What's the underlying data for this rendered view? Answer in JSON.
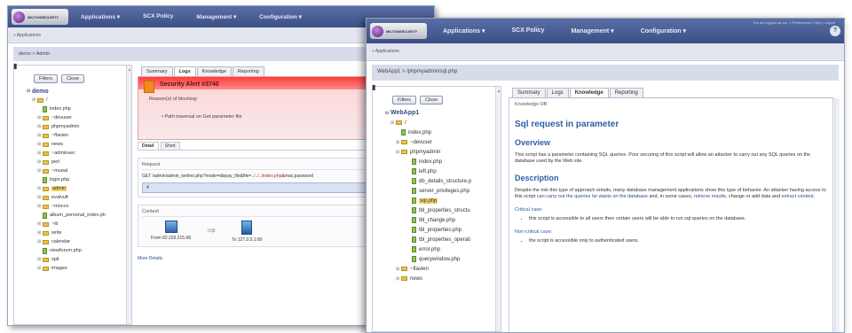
{
  "colors": {
    "nav": "#3b4f86",
    "alert": "#ff3b3b",
    "heading": "#2d5fa8"
  },
  "back": {
    "logo_text": "MILTONSECURITY",
    "menu": [
      "Applications ▾",
      "SCX Policy",
      "Management ▾",
      "Configuration ▾"
    ],
    "bar1": "» Applications",
    "breadcrumb": "demo > Admin",
    "buttons": {
      "filters": "Filters",
      "close": "Close"
    },
    "tree": [
      {
        "label": "demo",
        "type": "root"
      },
      {
        "label": "/",
        "type": "folder"
      },
      {
        "label": "index.php",
        "type": "file"
      },
      {
        "label": "~devuser",
        "type": "folder"
      },
      {
        "label": "phpmyadmin",
        "type": "folder"
      },
      {
        "label": "~flavien",
        "type": "folder"
      },
      {
        "label": "news",
        "type": "folder"
      },
      {
        "label": "~adminsec",
        "type": "folder"
      },
      {
        "label": "perl",
        "type": "folder"
      },
      {
        "label": "~mueal",
        "type": "folder"
      },
      {
        "label": "login.php",
        "type": "file"
      },
      {
        "label": "admin",
        "type": "folder",
        "selected": true
      },
      {
        "label": "evalvuft",
        "type": "folder"
      },
      {
        "label": "~mocco",
        "type": "folder"
      },
      {
        "label": "album_personal_index.ph",
        "type": "file"
      },
      {
        "label": "~iti",
        "type": "folder"
      },
      {
        "label": "write",
        "type": "folder"
      },
      {
        "label": "calendar",
        "type": "folder"
      },
      {
        "label": "viewforum.php",
        "type": "file"
      },
      {
        "label": "spit",
        "type": "folder"
      },
      {
        "label": "images",
        "type": "folder"
      }
    ],
    "tabs": [
      "Summary",
      "Logs",
      "Knowledge",
      "Reporting"
    ],
    "alert": {
      "title": "Security Alert #3740",
      "reason": "Reason(s) of blocking:",
      "bullet": "• Path traversal on Get parameter file"
    },
    "subtabs": [
      "Detail",
      "Short"
    ],
    "request": {
      "header": "Request",
      "line_start": "GET /admin/admin_welrno.php?mode=dispay_file&file=",
      "line_hl": "../../../index.php",
      "line_end": "&mac;password",
      "box": "4"
    },
    "context": {
      "header": "Context",
      "from": "From 82.226.215.68",
      "to": "To 127.0.0.1:80"
    },
    "more": "More Details"
  },
  "front": {
    "logo_text": "MILTONSECURITY",
    "session": "You are logged as ad... | Preferences | Help | Logout",
    "menu": [
      "Applications ▾",
      "SCX Policy",
      "Management ▾",
      "Configuration ▾"
    ],
    "help": "?",
    "bar1": "» Applications",
    "breadcrumb": "WebApp1 > /phpmyadmin/sql.php",
    "buttons": {
      "filters": "Filters",
      "close": "Close"
    },
    "tree": [
      {
        "label": "WebApp1",
        "type": "root"
      },
      {
        "label": "/",
        "type": "folder"
      },
      {
        "label": "index.php",
        "type": "file"
      },
      {
        "label": "~devuser",
        "type": "folder"
      },
      {
        "label": "phpmyadmin",
        "type": "folder"
      },
      {
        "label": "index.php",
        "type": "file"
      },
      {
        "label": "left.php",
        "type": "file"
      },
      {
        "label": "db_details_structure.p",
        "type": "file"
      },
      {
        "label": "server_privileges.php",
        "type": "file"
      },
      {
        "label": "sql.php",
        "type": "file",
        "selected": true
      },
      {
        "label": "tbl_properties_structu",
        "type": "file"
      },
      {
        "label": "tbl_change.php",
        "type": "file"
      },
      {
        "label": "tbl_properties.php",
        "type": "file"
      },
      {
        "label": "tbl_properties_operati",
        "type": "file"
      },
      {
        "label": "error.php",
        "type": "file"
      },
      {
        "label": "querywindow.php",
        "type": "file"
      },
      {
        "label": "~flavien",
        "type": "folder"
      },
      {
        "label": "news",
        "type": "folder"
      }
    ],
    "tabs": [
      "Summary",
      "Logs",
      "Knowledge",
      "Reporting"
    ],
    "kb": {
      "id": "Knowledge DB",
      "title": "Sql request in parameter",
      "overview_h": "Overview",
      "overview": "This script has a parameter containing SQL queries. Poor securing of this script will allow an attacker to carry out any SQL queries on the database used by the Web site.",
      "description_h": "Description",
      "desc1": "Despite the risk this type of approach entails, many database management applications show this type of behavior. An attacker having access to this script",
      "desc_link1": "can carry out the queries he wants on the database",
      "desc2": "and, in some cases,",
      "desc_link2": "retrieve results",
      "desc3": ", change or add data and",
      "desc_link3": "extract content",
      "desc4": ".",
      "critical_h": "Critical case:",
      "critical_item": "this script is accessible to all users then certain users will be able to run sql queries on the database.",
      "noncritical_h": "Non-critical case:",
      "noncritical_item": "the script is accessible only to authenticated users."
    }
  }
}
